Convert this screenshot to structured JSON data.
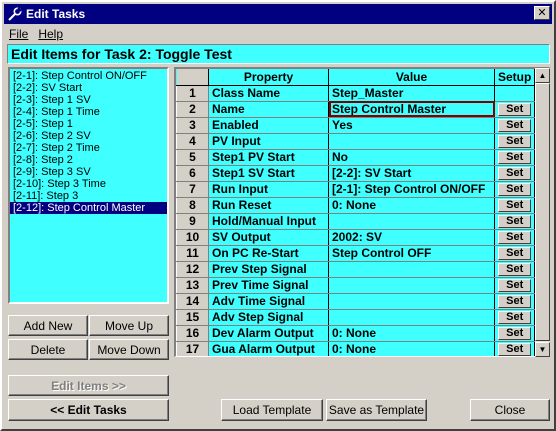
{
  "window": {
    "title": "Edit Tasks",
    "close_label": "✕"
  },
  "menu": [
    {
      "label": "File"
    },
    {
      "label": "Help"
    }
  ],
  "header": "Edit Items for Task 2: Toggle Test",
  "task_items": [
    "[2-1]: Step Control ON/OFF",
    "[2-2]: SV Start",
    "[2-3]: Step 1 SV",
    "[2-4]: Step 1 Time",
    "[2-5]: Step 1",
    "[2-6]: Step 2 SV",
    "[2-7]: Step 2 Time",
    "[2-8]: Step 2",
    "[2-9]: Step 3 SV",
    "[2-10]: Step 3 Time",
    "[2-11]: Step 3",
    "[2-12]: Step Control Master"
  ],
  "selected_item_index": 11,
  "buttons": {
    "add_new": "Add New",
    "move_up": "Move Up",
    "delete": "Delete",
    "move_down": "Move Down",
    "edit_items": "Edit Items >>",
    "edit_tasks": "<< Edit Tasks",
    "load_template": "Load Template",
    "save_template": "Save as Template",
    "close": "Close"
  },
  "grid": {
    "columns": [
      "Property",
      "Value",
      "Setup"
    ],
    "set_label": "Set",
    "rows": [
      {
        "num": "1",
        "property": "Class Name",
        "value": "Step_Master",
        "has_set": false
      },
      {
        "num": "2",
        "property": "Name",
        "value": "Step Control Master",
        "has_set": true,
        "selected": true
      },
      {
        "num": "3",
        "property": "Enabled",
        "value": "Yes",
        "has_set": true
      },
      {
        "num": "4",
        "property": "PV Input",
        "value": "",
        "has_set": true
      },
      {
        "num": "5",
        "property": "Step1 PV Start",
        "value": "No",
        "has_set": true
      },
      {
        "num": "6",
        "property": "Step1 SV Start",
        "value": "[2-2]: SV Start",
        "has_set": true
      },
      {
        "num": "7",
        "property": "Run Input",
        "value": "[2-1]: Step Control ON/OFF",
        "has_set": true
      },
      {
        "num": "8",
        "property": "Run Reset",
        "value": "0: None",
        "has_set": true
      },
      {
        "num": "9",
        "property": "Hold/Manual Input",
        "value": "",
        "has_set": true
      },
      {
        "num": "10",
        "property": "SV Output",
        "value": "2002: SV",
        "has_set": true
      },
      {
        "num": "11",
        "property": "On PC Re-Start",
        "value": "Step Control OFF",
        "has_set": true
      },
      {
        "num": "12",
        "property": "Prev Step Signal",
        "value": "",
        "has_set": true
      },
      {
        "num": "13",
        "property": "Prev Time Signal",
        "value": "",
        "has_set": true
      },
      {
        "num": "14",
        "property": "Adv Time Signal",
        "value": "",
        "has_set": true
      },
      {
        "num": "15",
        "property": "Adv Step Signal",
        "value": "",
        "has_set": true
      },
      {
        "num": "16",
        "property": "Dev Alarm Output",
        "value": "0: None",
        "has_set": true
      },
      {
        "num": "17",
        "property": "Gua Alarm Output",
        "value": "0: None",
        "has_set": true
      }
    ]
  },
  "colors": {
    "titlebar": "#000080",
    "cyan": "#40ffff",
    "selection": "#000080",
    "face": "#d4d0c8"
  }
}
